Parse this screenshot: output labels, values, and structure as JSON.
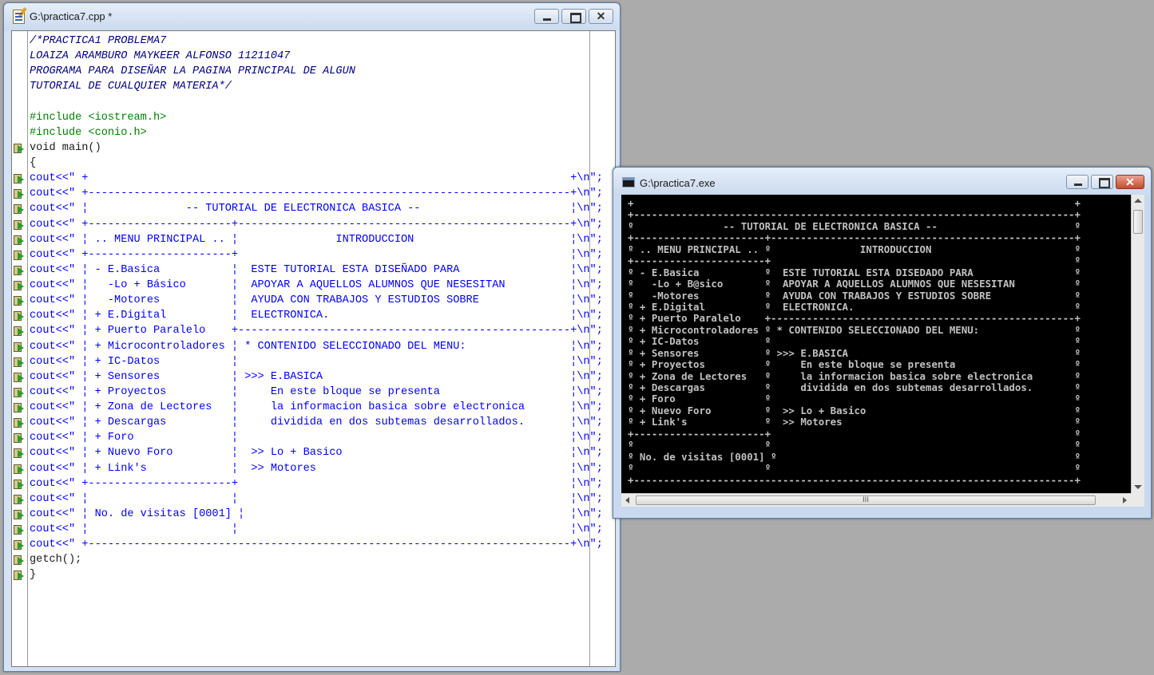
{
  "editor": {
    "title": "G:\\practica7.cpp *",
    "icon": "cpp-file-icon",
    "lines": [
      {
        "text": "/*PRACTICA1 PROBLEMA7",
        "kind": "comment",
        "breakpoint": false
      },
      {
        "text": "LOAIZA ARAMBURO MAYKEER ALFONSO 11211047",
        "kind": "comment",
        "breakpoint": false
      },
      {
        "text": "PROGRAMA PARA DISEÑAR LA PAGINA PRINCIPAL DE ALGUN",
        "kind": "comment",
        "breakpoint": false
      },
      {
        "text": "TUTORIAL DE CUALQUIER MATERIA*/",
        "kind": "comment",
        "breakpoint": false
      },
      {
        "text": "",
        "kind": "plain",
        "breakpoint": false
      },
      {
        "text": "#include <iostream.h>",
        "kind": "pre",
        "breakpoint": false
      },
      {
        "text": "#include <conio.h>",
        "kind": "pre",
        "breakpoint": false
      },
      {
        "text": "void main()",
        "kind": "plain",
        "breakpoint": true
      },
      {
        "text": "{",
        "kind": "plain",
        "breakpoint": false
      },
      {
        "text": "cout<<\" +                                                                          +\\n\";",
        "kind": "str",
        "breakpoint": true
      },
      {
        "text": "cout<<\" +--------------------------------------------------------------------------+\\n\";",
        "kind": "str",
        "breakpoint": true
      },
      {
        "text": "cout<<\" ¦               -- TUTORIAL DE ELECTRONICA BASICA --                       ¦\\n\";",
        "kind": "str",
        "breakpoint": true
      },
      {
        "text": "cout<<\" +----------------------+---------------------------------------------------+\\n\";",
        "kind": "str",
        "breakpoint": true
      },
      {
        "text": "cout<<\" ¦ .. MENU PRINCIPAL .. ¦               INTRODUCCION                        ¦\\n\";",
        "kind": "str",
        "breakpoint": true
      },
      {
        "text": "cout<<\" +----------------------+                                                   ¦\\n\";",
        "kind": "str",
        "breakpoint": true
      },
      {
        "text": "cout<<\" ¦ - E.Basica           ¦  ESTE TUTORIAL ESTA DISEÑADO PARA                 ¦\\n\";",
        "kind": "str",
        "breakpoint": true
      },
      {
        "text": "cout<<\" ¦   -Lo + Básico       ¦  APOYAR A AQUELLOS ALUMNOS QUE NESESITAN          ¦\\n\";",
        "kind": "str",
        "breakpoint": true
      },
      {
        "text": "cout<<\" ¦   -Motores           ¦  AYUDA CON TRABAJOS Y ESTUDIOS SOBRE              ¦\\n\";",
        "kind": "str",
        "breakpoint": true
      },
      {
        "text": "cout<<\" ¦ + E.Digital          ¦  ELECTRONICA.                                     ¦\\n\";",
        "kind": "str",
        "breakpoint": true
      },
      {
        "text": "cout<<\" ¦ + Puerto Paralelo    +---------------------------------------------------+\\n\";",
        "kind": "str",
        "breakpoint": true
      },
      {
        "text": "cout<<\" ¦ + Microcontroladores ¦ * CONTENIDO SELECCIONADO DEL MENU:                ¦\\n\";",
        "kind": "str",
        "breakpoint": true
      },
      {
        "text": "cout<<\" ¦ + IC-Datos           ¦                                                   ¦\\n\";",
        "kind": "str",
        "breakpoint": true
      },
      {
        "text": "cout<<\" ¦ + Sensores           ¦ >>> E.BASICA                                      ¦\\n\";",
        "kind": "str",
        "breakpoint": true
      },
      {
        "text": "cout<<\" ¦ + Proyectos          ¦     En este bloque se presenta                    ¦\\n\";",
        "kind": "str",
        "breakpoint": true
      },
      {
        "text": "cout<<\" ¦ + Zona de Lectores   ¦     la informacion basica sobre electronica       ¦\\n\";",
        "kind": "str",
        "breakpoint": true
      },
      {
        "text": "cout<<\" ¦ + Descargas          ¦     dividida en dos subtemas desarrollados.       ¦\\n\";",
        "kind": "str",
        "breakpoint": true
      },
      {
        "text": "cout<<\" ¦ + Foro               ¦                                                   ¦\\n\";",
        "kind": "str",
        "breakpoint": true
      },
      {
        "text": "cout<<\" ¦ + Nuevo Foro         ¦  >> Lo + Basico                                   ¦\\n\";",
        "kind": "str",
        "breakpoint": true
      },
      {
        "text": "cout<<\" ¦ + Link's             ¦  >> Motores                                       ¦\\n\";",
        "kind": "str",
        "breakpoint": true
      },
      {
        "text": "cout<<\" +----------------------+                                                   ¦\\n\";",
        "kind": "str",
        "breakpoint": true
      },
      {
        "text": "cout<<\" ¦                      ¦                                                   ¦\\n\";",
        "kind": "str",
        "breakpoint": true
      },
      {
        "text": "cout<<\" ¦ No. de visitas [0001] ¦                                                  ¦\\n\";",
        "kind": "str",
        "breakpoint": true
      },
      {
        "text": "cout<<\" ¦                      ¦                                                   ¦\\n\";",
        "kind": "str",
        "breakpoint": true
      },
      {
        "text": "cout<<\" +--------------------------------------------------------------------------+\\n\";",
        "kind": "str",
        "breakpoint": true
      },
      {
        "text": "getch();",
        "kind": "plain",
        "breakpoint": true
      },
      {
        "text": "}",
        "kind": "plain",
        "breakpoint": true
      }
    ]
  },
  "console": {
    "title": "G:\\practica7.exe",
    "icon": "console-app-icon",
    "hscroll_grip": "III",
    "lines": [
      "+                                                                          +",
      "+--------------------------------------------------------------------------+",
      "º               -- TUTORIAL DE ELECTRONICA BASICA --                       º",
      "+----------------------+---------------------------------------------------+",
      "º .. MENU PRINCIPAL .. º               INTRODUCCION                        º",
      "+----------------------+                                                   º",
      "º - E.Basica           º  ESTE TUTORIAL ESTA DISEDADO PARA                 º",
      "º   -Lo + B@sico       º  APOYAR A AQUELLOS ALUMNOS QUE NESESITAN          º",
      "º   -Motores           º  AYUDA CON TRABAJOS Y ESTUDIOS SOBRE              º",
      "º + E.Digital          º  ELECTRONICA.                                     º",
      "º + Puerto Paralelo    +---------------------------------------------------+",
      "º + Microcontroladores º * CONTENIDO SELECCIONADO DEL MENU:                º",
      "º + IC-Datos           º                                                   º",
      "º + Sensores           º >>> E.BASICA                                      º",
      "º + Proyectos          º     En este bloque se presenta                    º",
      "º + Zona de Lectores   º     la informacion basica sobre electronica       º",
      "º + Descargas          º     dividida en dos subtemas desarrollados.       º",
      "º + Foro               º                                                   º",
      "º + Nuevo Foro         º  >> Lo + Basico                                   º",
      "º + Link's             º  >> Motores                                       º",
      "+----------------------+                                                   º",
      "º                      º                                                   º",
      "º No. de visitas [0001] º                                                  º",
      "º                      º                                                   º",
      "+--------------------------------------------------------------------------+",
      ""
    ]
  },
  "colors": {
    "comment": "#000080",
    "preprocessor": "#008000",
    "string": "#0000ff",
    "console_bg": "#000000",
    "console_fg": "#c0c0c0",
    "desktop": "#ababab"
  }
}
